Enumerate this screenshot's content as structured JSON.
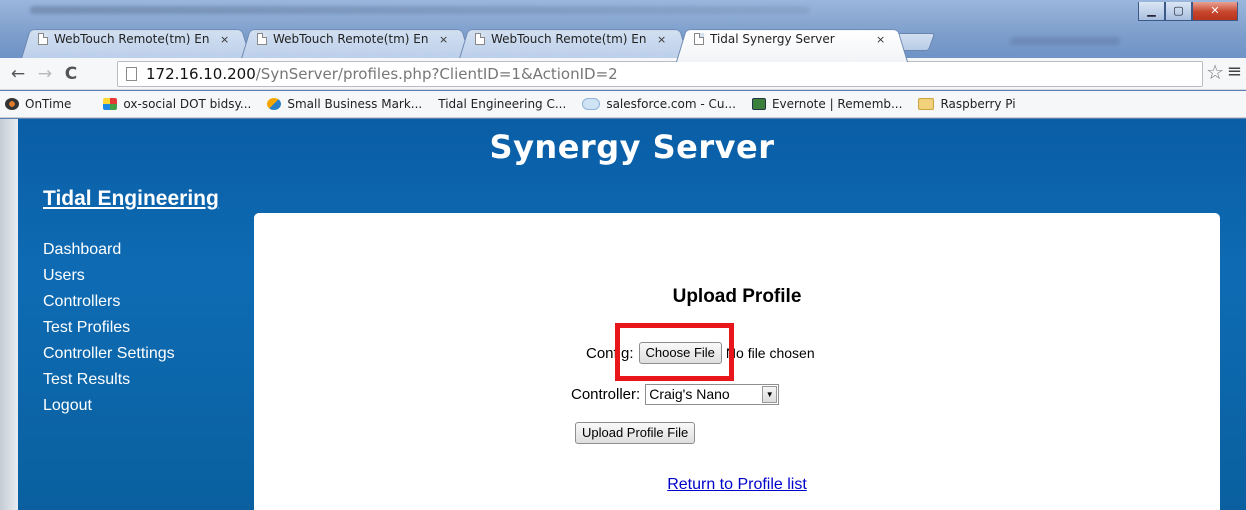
{
  "browser": {
    "tabs": [
      {
        "title": "WebTouch Remote(tm) En",
        "close": "×"
      },
      {
        "title": "WebTouch Remote(tm) En",
        "close": "×"
      },
      {
        "title": "WebTouch Remote(tm) En",
        "close": "×"
      },
      {
        "title": "Tidal Synergy Server",
        "close": "×"
      }
    ],
    "address": {
      "host": "172.16.10.200",
      "path": "/SynServer/profiles.php?ClientID=1&ActionID=2"
    },
    "bookmarks": [
      {
        "label": "OnTime",
        "icon": "ontime-icon"
      },
      {
        "label": "",
        "icon": "page-icon"
      },
      {
        "label": "ox-social DOT bidsy...",
        "icon": "ox-social-icon"
      },
      {
        "label": "Small Business Mark...",
        "icon": "small-business-icon"
      },
      {
        "label": "Tidal Engineering C...",
        "icon": "page-icon"
      },
      {
        "label": "salesforce.com - Cu...",
        "icon": "salesforce-icon"
      },
      {
        "label": "Evernote | Rememb...",
        "icon": "evernote-icon"
      },
      {
        "label": "Raspberry Pi",
        "icon": "folder-icon"
      }
    ]
  },
  "site": {
    "title": "Synergy Server",
    "brand": "Tidal Engineering",
    "nav": [
      "Dashboard",
      "Users",
      "Controllers",
      "Test Profiles",
      "Controller Settings",
      "Test Results",
      "Logout"
    ]
  },
  "upload_form": {
    "heading": "Upload Profile",
    "config_label": "Config:",
    "choose_file_label": "Choose File",
    "file_status": "No file chosen",
    "controller_label": "Controller:",
    "controller_selected": "Craig's Nano",
    "submit_label": "Upload Profile File",
    "return_link": "Return to Profile list"
  },
  "colors": {
    "header_blue": "#0e6bb3",
    "highlight_red": "#e8161b",
    "link_blue": "#0000cc"
  }
}
